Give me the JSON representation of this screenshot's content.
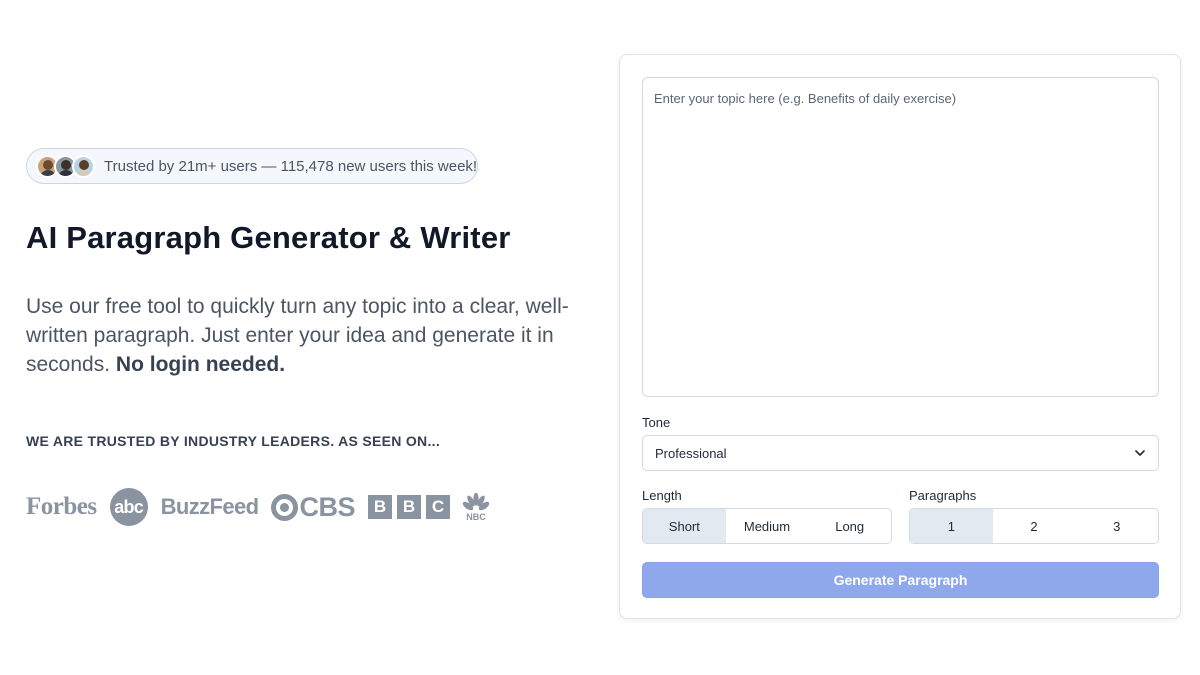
{
  "hero": {
    "trust_text": "Trusted by 21m+ users — 115,478 new users this week!",
    "title": "AI Paragraph Generator & Writer",
    "description": "Use our free tool to quickly turn any topic into a clear, well-written paragraph. Just enter your idea and generate it in seconds.",
    "description_bold": "No login needed.",
    "trusted_label": "WE ARE TRUSTED BY INDUSTRY LEADERS. AS SEEN ON...",
    "logos": {
      "forbes": "Forbes",
      "abc": "abc",
      "buzzfeed": "BuzzFeed",
      "cbs": "CBS",
      "bbc": [
        "B",
        "B",
        "C"
      ],
      "nbc": "NBC"
    }
  },
  "form": {
    "topic_placeholder": "Enter your topic here (e.g. Benefits of daily exercise)",
    "tone_label": "Tone",
    "tone_value": "Professional",
    "length_label": "Length",
    "length_options": [
      "Short",
      "Medium",
      "Long"
    ],
    "length_selected": "Short",
    "paragraphs_label": "Paragraphs",
    "paragraph_options": [
      "1",
      "2",
      "3"
    ],
    "paragraphs_selected": "1",
    "generate_label": "Generate Paragraph"
  },
  "icons": {
    "tone_dropdown": "chevron-down-icon",
    "nbc": "peacock-icon"
  },
  "colors": {
    "generate_button": "#8fa8ec",
    "segment_active": "#e3e9f0",
    "logo_gray": "#8a93a0"
  }
}
